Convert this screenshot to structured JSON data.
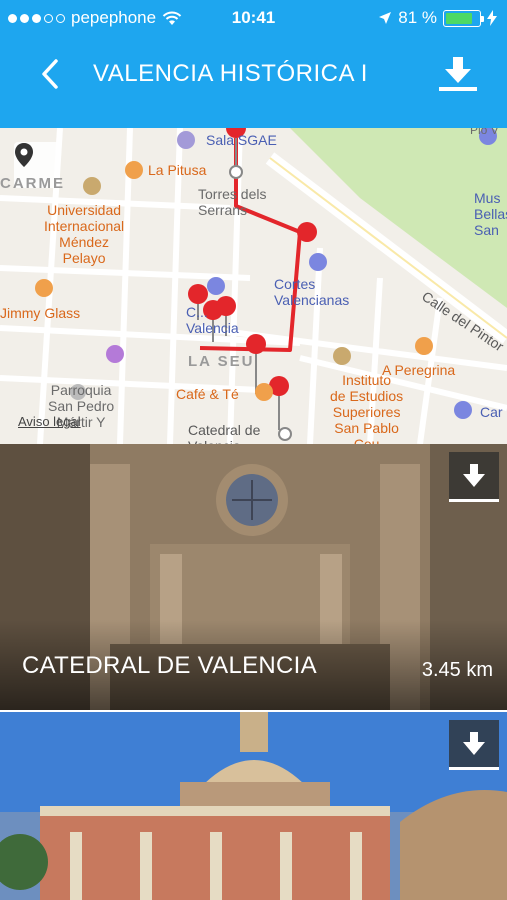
{
  "status_bar": {
    "carrier": "pepephone",
    "time": "10:41",
    "battery": "81 %",
    "battery_level": 0.81
  },
  "navbar": {
    "title": "VALENCIA HISTÓRICA I"
  },
  "map": {
    "legal_link": "Aviso legal",
    "labels": {
      "sala_sgae": "Sala SGAE",
      "la_pitusa": "La Pitusa",
      "torres_serrans": "Torres dels\nSerrans",
      "carme": "CARME",
      "universidad": "Universidad\nInternacional\nMéndez\nPelayo",
      "cortes": "Cortes\nValencianas",
      "jimmy_glass": "Jimmy Glass",
      "la_seu": "LA SEU",
      "plaza_virgen": "C...\nValencia",
      "cafe_te": "Café & Té",
      "instituto": "Instituto\nde Estudios\nSuperiores\nSan Pablo\nCeu",
      "a_peregrina": "A Peregrina",
      "catedral": "Catedral de\nValencia",
      "parroquia": "Parroquia\nSan Pedro\nMártir Y",
      "calle_pintor": "Calle del Pintor",
      "museo": "Mus\nBellas\nSan",
      "car": "Car",
      "place_top_right": "Plo V"
    },
    "colors": {
      "route": "#e3262b",
      "pin": "#e3262b",
      "park": "#cfe8b4",
      "water_road": "#ffffff"
    }
  },
  "cards": [
    {
      "title": "CATEDRAL DE VALENCIA",
      "distance": "3.45 km"
    },
    {
      "title": "",
      "distance": ""
    }
  ],
  "icons": {
    "back": "chevron-left-icon",
    "download": "download-icon",
    "locate": "location-pin-icon",
    "wifi": "wifi-icon",
    "location_arrow": "location-arrow-icon",
    "charging": "charging-bolt-icon"
  },
  "theme": {
    "header_bg": "#1ea6ef",
    "accent_orange": "#d9681b",
    "accent_blue": "#4a5fb3"
  }
}
